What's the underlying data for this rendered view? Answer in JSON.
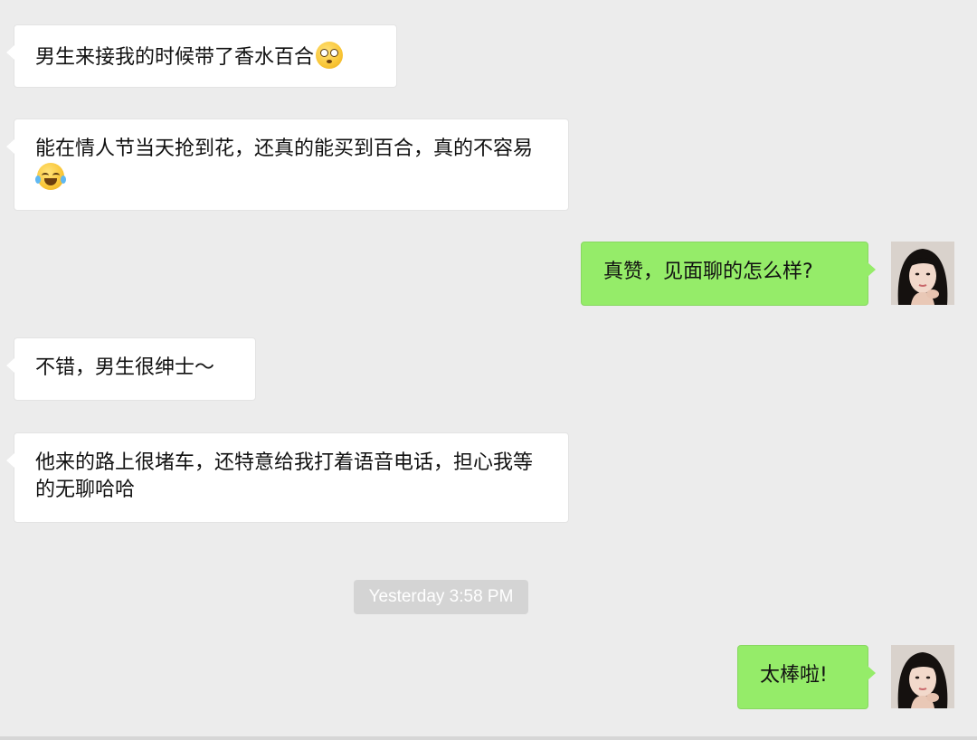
{
  "messages": [
    {
      "side": "in",
      "text": "男生来接我的时候带了香水百合",
      "emoji": "flushed-face-emoji"
    },
    {
      "side": "in",
      "text": "能在情人节当天抢到花，还真的能买到百合，真的不容易",
      "emoji": "face-with-tears-of-joy-emoji"
    },
    {
      "side": "out",
      "text": "真赞，见面聊的怎么样?"
    },
    {
      "side": "in",
      "text": "不错，男生很绅士～"
    },
    {
      "side": "in",
      "text": "他来的路上很堵车，还特意给我打着语音电话，担心我等的无聊哈哈"
    },
    {
      "side": "out",
      "text": "太棒啦!"
    }
  ],
  "timestamp": "Yesterday 3:58 PM",
  "colors": {
    "background": "#ececec",
    "incoming_bubble": "#ffffff",
    "outgoing_bubble": "#95ec69",
    "timestamp_bg": "#d4d4d4"
  }
}
